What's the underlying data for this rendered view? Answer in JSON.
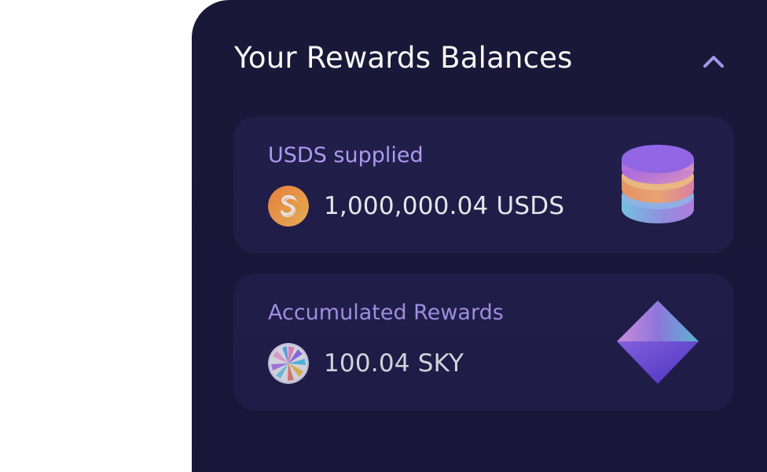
{
  "header": {
    "title": "Your Rewards Balances",
    "collapse_icon": "chevron-up-icon"
  },
  "cards": [
    {
      "label": "USDS supplied",
      "amount": "1,000,000.04 USDS",
      "token_icon": "usds-icon",
      "illustration": "stacked-coins-icon"
    },
    {
      "label": "Accumulated Rewards",
      "amount": "100.04 SKY",
      "token_icon": "sky-icon",
      "illustration": "diamond-icon"
    }
  ],
  "colors": {
    "panel_bg": "#1a1838",
    "card_bg": "#221f4a",
    "label": "#b9a6ff",
    "text": "#ffffff",
    "chevron": "#a99bf0"
  }
}
